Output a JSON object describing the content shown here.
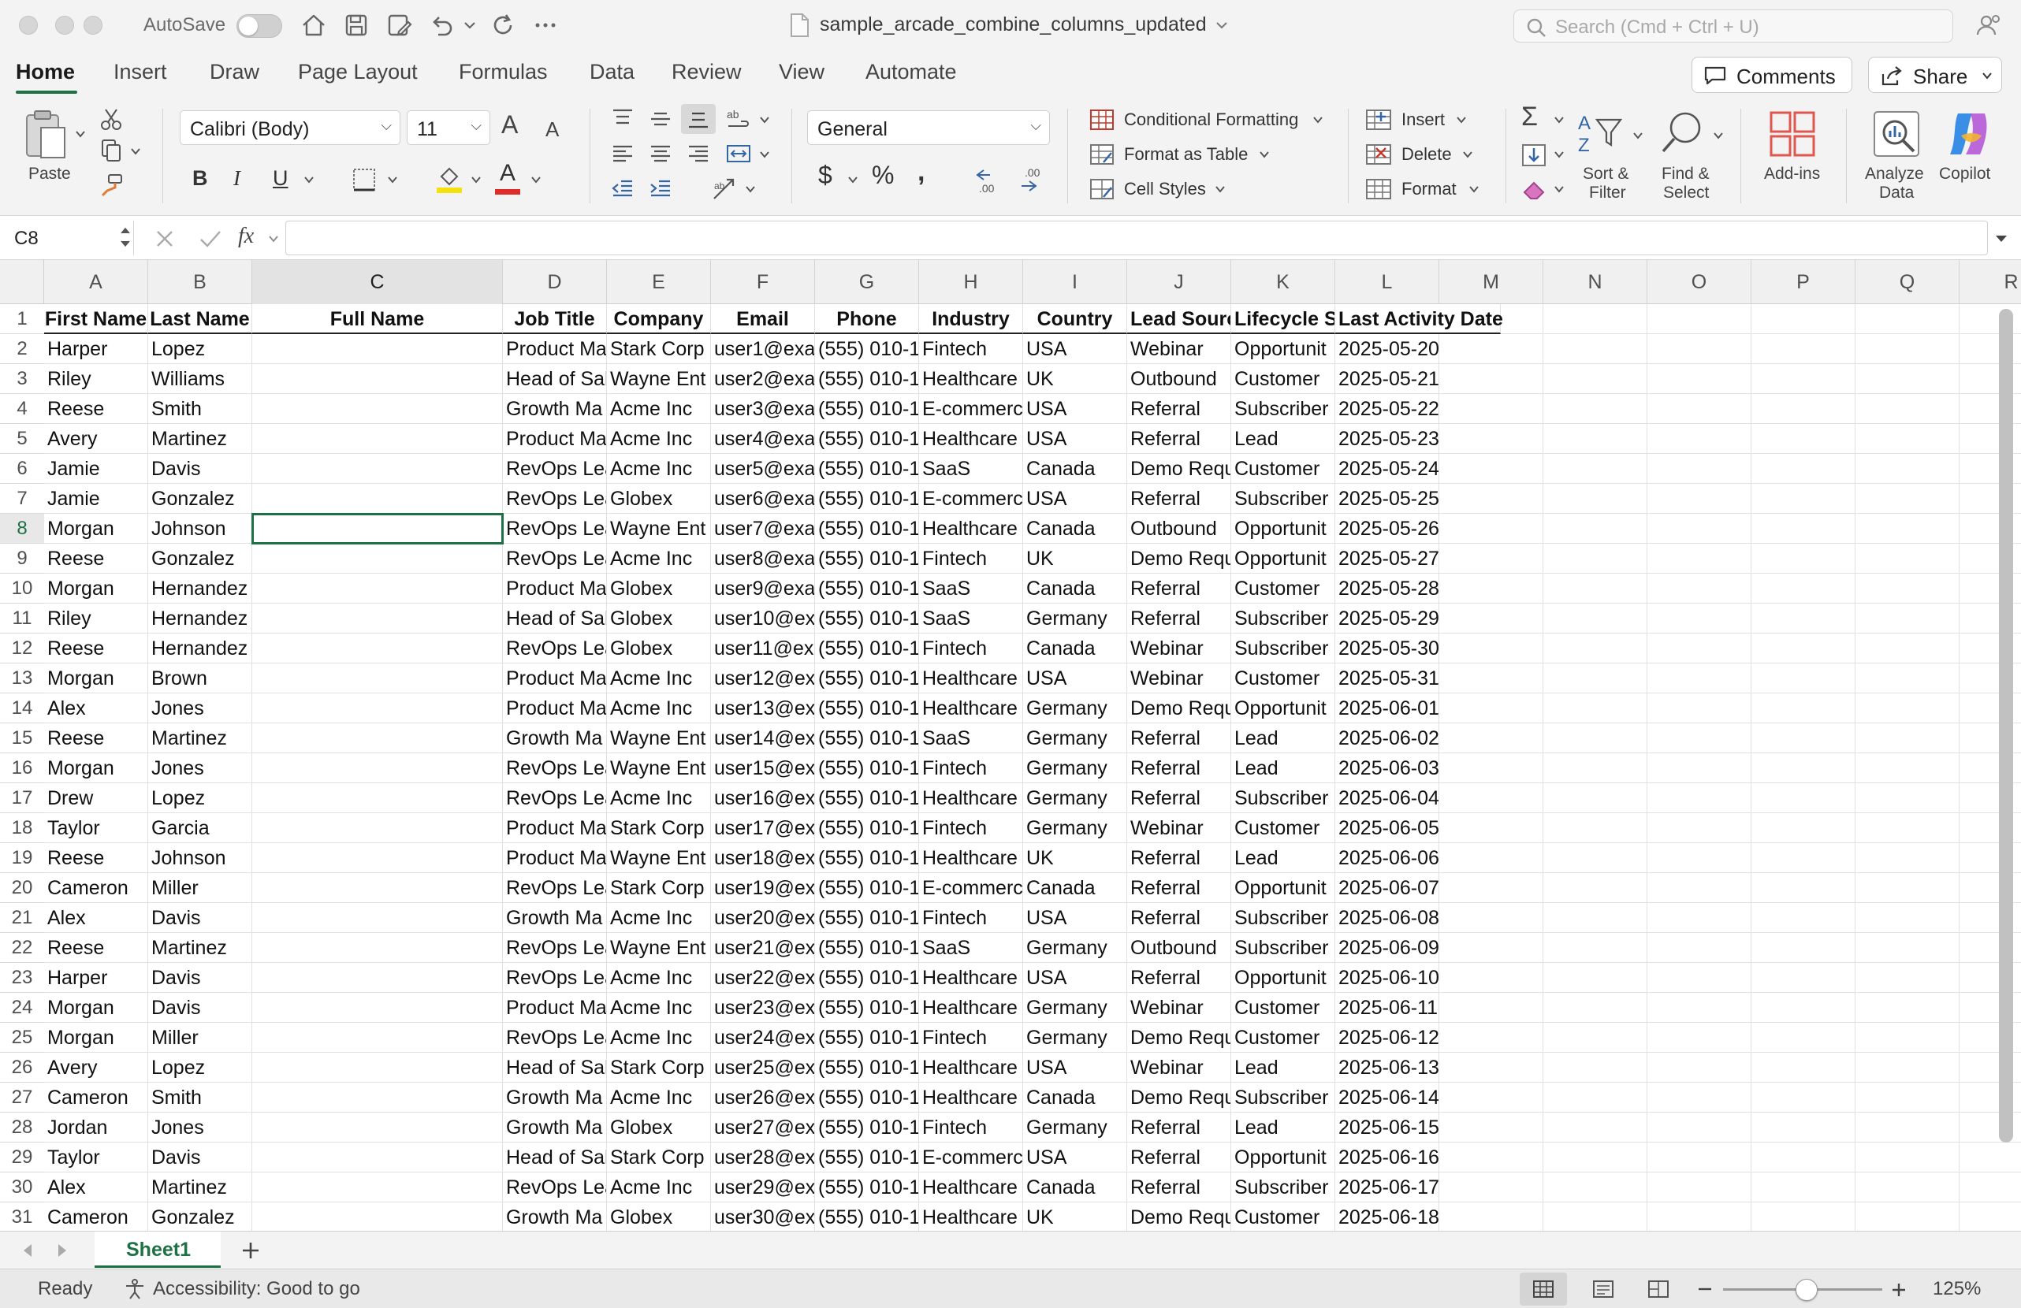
{
  "titlebar": {
    "autosave_label": "AutoSave",
    "doc_title": "sample_arcade_combine_columns_updated",
    "search_placeholder": "Search (Cmd + Ctrl + U)"
  },
  "ribbon_tabs": [
    "Home",
    "Insert",
    "Draw",
    "Page Layout",
    "Formulas",
    "Data",
    "Review",
    "View",
    "Automate"
  ],
  "ribbon_buttons": {
    "comments": "Comments",
    "share": "Share"
  },
  "ribbon": {
    "paste": "Paste",
    "font_name": "Calibri (Body)",
    "font_size": "11",
    "number_format": "General",
    "conditional_formatting": "Conditional Formatting",
    "format_as_table": "Format as Table",
    "cell_styles": "Cell Styles",
    "insert": "Insert",
    "delete": "Delete",
    "format": "Format",
    "sort_filter_1": "Sort &",
    "sort_filter_2": "Filter",
    "find_select_1": "Find &",
    "find_select_2": "Select",
    "add_ins": "Add-ins",
    "analyze_1": "Analyze",
    "analyze_2": "Data",
    "copilot": "Copilot",
    "bold": "B",
    "italic": "I",
    "underline": "U",
    "percent": "%",
    "dollar": "$",
    "comma": ",",
    "grow_font": "A",
    "shrink_font": "A",
    "font_color": "A"
  },
  "formula_bar": {
    "name_box": "C8",
    "fx_label": "fx",
    "value": ""
  },
  "accent_color": "#1e7145",
  "columns": [
    "A",
    "B",
    "C",
    "D",
    "E",
    "F",
    "G",
    "H",
    "I",
    "J",
    "K",
    "L",
    "M",
    "N",
    "O",
    "P",
    "Q",
    "R"
  ],
  "headers": [
    "First Name",
    "Last Name",
    "Full Name",
    "Job Title",
    "Company",
    "Email",
    "Phone",
    "Industry",
    "Country",
    "Lead Source",
    "Lifecycle Stage",
    "Last Activity Date"
  ],
  "rows": [
    [
      "Harper",
      "Lopez",
      "",
      "Product Ma",
      "Stark Corp",
      "user1@exa",
      "(555) 010-1",
      "Fintech",
      "USA",
      "Webinar",
      "Opportunit",
      "2025-05-20"
    ],
    [
      "Riley",
      "Williams",
      "",
      "Head of Sal",
      "Wayne Ent",
      "user2@exa",
      "(555) 010-1",
      "Healthcare",
      "UK",
      "Outbound",
      "Customer",
      "2025-05-21"
    ],
    [
      "Reese",
      "Smith",
      "",
      "Growth Ma",
      "Acme Inc",
      "user3@exa",
      "(555) 010-1",
      "E-commerc",
      "USA",
      "Referral",
      "Subscriber",
      "2025-05-22"
    ],
    [
      "Avery",
      "Martinez",
      "",
      "Product Ma",
      "Acme Inc",
      "user4@exa",
      "(555) 010-1",
      "Healthcare",
      "USA",
      "Referral",
      "Lead",
      "2025-05-23"
    ],
    [
      "Jamie",
      "Davis",
      "",
      "RevOps Lea",
      "Acme Inc",
      "user5@exa",
      "(555) 010-1",
      "SaaS",
      "Canada",
      "Demo Requ",
      "Customer",
      "2025-05-24"
    ],
    [
      "Jamie",
      "Gonzalez",
      "",
      "RevOps Lea",
      "Globex",
      "user6@exa",
      "(555) 010-1",
      "E-commerc",
      "USA",
      "Referral",
      "Subscriber",
      "2025-05-25"
    ],
    [
      "Morgan",
      "Johnson",
      "",
      "RevOps Lea",
      "Wayne Ent",
      "user7@exa",
      "(555) 010-1",
      "Healthcare",
      "Canada",
      "Outbound",
      "Opportunit",
      "2025-05-26"
    ],
    [
      "Reese",
      "Gonzalez",
      "",
      "RevOps Lea",
      "Acme Inc",
      "user8@exa",
      "(555) 010-1",
      "Fintech",
      "UK",
      "Demo Requ",
      "Opportunit",
      "2025-05-27"
    ],
    [
      "Morgan",
      "Hernandez",
      "",
      "Product Ma",
      "Globex",
      "user9@exa",
      "(555) 010-1",
      "SaaS",
      "Canada",
      "Referral",
      "Customer",
      "2025-05-28"
    ],
    [
      "Riley",
      "Hernandez",
      "",
      "Head of Sal",
      "Globex",
      "user10@ex",
      "(555) 010-1",
      "SaaS",
      "Germany",
      "Referral",
      "Subscriber",
      "2025-05-29"
    ],
    [
      "Reese",
      "Hernandez",
      "",
      "RevOps Lea",
      "Globex",
      "user11@ex",
      "(555) 010-1",
      "Fintech",
      "Canada",
      "Webinar",
      "Subscriber",
      "2025-05-30"
    ],
    [
      "Morgan",
      "Brown",
      "",
      "Product Ma",
      "Acme Inc",
      "user12@ex",
      "(555) 010-1",
      "Healthcare",
      "USA",
      "Webinar",
      "Customer",
      "2025-05-31"
    ],
    [
      "Alex",
      "Jones",
      "",
      "Product Ma",
      "Acme Inc",
      "user13@ex",
      "(555) 010-1",
      "Healthcare",
      "Germany",
      "Demo Requ",
      "Opportunit",
      "2025-06-01"
    ],
    [
      "Reese",
      "Martinez",
      "",
      "Growth Ma",
      "Wayne Ent",
      "user14@ex",
      "(555) 010-1",
      "SaaS",
      "Germany",
      "Referral",
      "Lead",
      "2025-06-02"
    ],
    [
      "Morgan",
      "Jones",
      "",
      "RevOps Lea",
      "Wayne Ent",
      "user15@ex",
      "(555) 010-1",
      "Fintech",
      "Germany",
      "Referral",
      "Lead",
      "2025-06-03"
    ],
    [
      "Drew",
      "Lopez",
      "",
      "RevOps Lea",
      "Acme Inc",
      "user16@ex",
      "(555) 010-1",
      "Healthcare",
      "Germany",
      "Referral",
      "Subscriber",
      "2025-06-04"
    ],
    [
      "Taylor",
      "Garcia",
      "",
      "Product Ma",
      "Stark Corp",
      "user17@ex",
      "(555) 010-1",
      "Fintech",
      "Germany",
      "Webinar",
      "Customer",
      "2025-06-05"
    ],
    [
      "Reese",
      "Johnson",
      "",
      "Product Ma",
      "Wayne Ent",
      "user18@ex",
      "(555) 010-1",
      "Healthcare",
      "UK",
      "Referral",
      "Lead",
      "2025-06-06"
    ],
    [
      "Cameron",
      "Miller",
      "",
      "RevOps Lea",
      "Stark Corp",
      "user19@ex",
      "(555) 010-1",
      "E-commerc",
      "Canada",
      "Referral",
      "Opportunit",
      "2025-06-07"
    ],
    [
      "Alex",
      "Davis",
      "",
      "Growth Ma",
      "Acme Inc",
      "user20@ex",
      "(555) 010-1",
      "Fintech",
      "USA",
      "Referral",
      "Subscriber",
      "2025-06-08"
    ],
    [
      "Reese",
      "Martinez",
      "",
      "RevOps Lea",
      "Wayne Ent",
      "user21@ex",
      "(555) 010-1",
      "SaaS",
      "Germany",
      "Outbound",
      "Subscriber",
      "2025-06-09"
    ],
    [
      "Harper",
      "Davis",
      "",
      "RevOps Lea",
      "Acme Inc",
      "user22@ex",
      "(555) 010-1",
      "Healthcare",
      "USA",
      "Referral",
      "Opportunit",
      "2025-06-10"
    ],
    [
      "Morgan",
      "Davis",
      "",
      "Product Ma",
      "Acme Inc",
      "user23@ex",
      "(555) 010-1",
      "Healthcare",
      "Germany",
      "Webinar",
      "Customer",
      "2025-06-11"
    ],
    [
      "Morgan",
      "Miller",
      "",
      "RevOps Lea",
      "Acme Inc",
      "user24@ex",
      "(555) 010-1",
      "Fintech",
      "Germany",
      "Demo Requ",
      "Customer",
      "2025-06-12"
    ],
    [
      "Avery",
      "Lopez",
      "",
      "Head of Sal",
      "Stark Corp",
      "user25@ex",
      "(555) 010-1",
      "Healthcare",
      "USA",
      "Webinar",
      "Lead",
      "2025-06-13"
    ],
    [
      "Cameron",
      "Smith",
      "",
      "Growth Ma",
      "Acme Inc",
      "user26@ex",
      "(555) 010-1",
      "Healthcare",
      "Canada",
      "Demo Requ",
      "Subscriber",
      "2025-06-14"
    ],
    [
      "Jordan",
      "Jones",
      "",
      "Growth Ma",
      "Globex",
      "user27@ex",
      "(555) 010-1",
      "Fintech",
      "Germany",
      "Referral",
      "Lead",
      "2025-06-15"
    ],
    [
      "Taylor",
      "Davis",
      "",
      "Head of Sal",
      "Stark Corp",
      "user28@ex",
      "(555) 010-1",
      "E-commerc",
      "USA",
      "Referral",
      "Opportunit",
      "2025-06-16"
    ],
    [
      "Alex",
      "Martinez",
      "",
      "RevOps Lea",
      "Acme Inc",
      "user29@ex",
      "(555) 010-1",
      "Healthcare",
      "Canada",
      "Referral",
      "Subscriber",
      "2025-06-17"
    ],
    [
      "Cameron",
      "Gonzalez",
      "",
      "Growth Ma",
      "Globex",
      "user30@ex",
      "(555) 010-1",
      "Healthcare",
      "UK",
      "Demo Requ",
      "Customer",
      "2025-06-18"
    ]
  ],
  "sheet_tabs": [
    "Sheet1"
  ],
  "status": {
    "ready": "Ready",
    "accessibility": "Accessibility: Good to go",
    "zoom": "125%"
  }
}
